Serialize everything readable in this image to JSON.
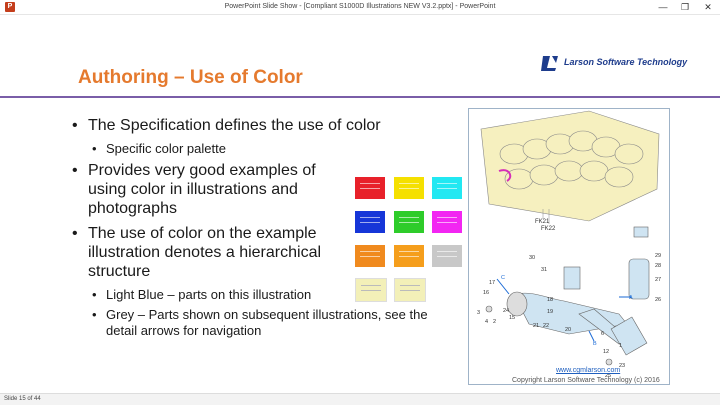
{
  "window": {
    "title": "PowerPoint Slide Show - [Compliant S1000D Illustrations NEW V3.2.pptx] - PowerPoint",
    "app_icon_letter": "P",
    "minimize_glyph": "—",
    "restore_glyph": "❐",
    "close_glyph": "✕"
  },
  "slide": {
    "title": "Authoring – Use of Color",
    "logo_text": "Larson Software Technology",
    "bullets": [
      {
        "text": "The Specification defines the use of color",
        "sub": [
          "Specific color palette"
        ]
      },
      {
        "text": "Provides very good examples of using color in illustrations and photographs",
        "sub": []
      },
      {
        "text": "The use of color on the example illustration denotes a hierarchical structure",
        "sub": [
          "Light Blue – parts on this illustration",
          "Grey – Parts shown on subsequent illustrations, see the detail arrows for navigation"
        ]
      }
    ],
    "swatch_colors": [
      "#e8212a",
      "#f5e000",
      "#22e8f2",
      "#1636d8",
      "#2ecc2a",
      "#f226f2",
      "#f08a1e",
      "#f59e1c",
      "#c8c8c8",
      "#f3f0b8",
      "#f3f0b8"
    ],
    "figure_labels": {
      "fk21": "FK21",
      "fk22": "FK22",
      "numbers": [
        "29",
        "28",
        "27",
        "26",
        "30",
        "31",
        "17",
        "16",
        "18",
        "19",
        "C",
        "24",
        "15",
        "3",
        "4",
        "2",
        "21",
        "22",
        "20",
        "6",
        "1",
        "12",
        "A",
        "B",
        "25",
        "23"
      ]
    },
    "url": "www.cgmlarson.com",
    "copyright": "Copyright Larson Software Technology (c) 2016"
  },
  "status": {
    "slide_counter": "Slide 15 of 44"
  }
}
